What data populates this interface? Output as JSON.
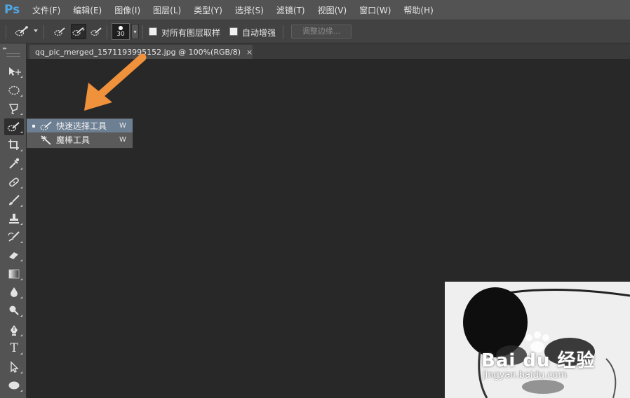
{
  "app": {
    "logo": "Ps"
  },
  "menu": [
    {
      "label": "文件(F)"
    },
    {
      "label": "编辑(E)"
    },
    {
      "label": "图像(I)"
    },
    {
      "label": "图层(L)"
    },
    {
      "label": "类型(Y)"
    },
    {
      "label": "选择(S)"
    },
    {
      "label": "滤镜(T)"
    },
    {
      "label": "视图(V)"
    },
    {
      "label": "窗口(W)"
    },
    {
      "label": "帮助(H)"
    }
  ],
  "options": {
    "brush_size": "30",
    "sample_all_layers": {
      "label": "对所有图层取样",
      "checked": false
    },
    "auto_enhance": {
      "label": "自动增强",
      "checked": false
    },
    "refine_edge": "调整边缘..."
  },
  "document": {
    "tab_title": "qq_pic_merged_1571193995152.jpg @ 100%(RGB/8)",
    "close_glyph": "×"
  },
  "flyout": {
    "items": [
      {
        "label": "快速选择工具",
        "shortcut": "W",
        "selected": true,
        "icon": "quick-selection-icon"
      },
      {
        "label": "魔棒工具",
        "shortcut": "W",
        "selected": false,
        "icon": "magic-wand-icon"
      }
    ]
  },
  "watermark": {
    "brand": "Bai du 经验",
    "url": "jingyan.baidu.com"
  },
  "colors": {
    "menubar": "#535353",
    "workspace": "#282828",
    "flyout_highlight": "#6d7f93",
    "annotation_arrow": "#f0913c",
    "logo": "#4fa8e6"
  }
}
